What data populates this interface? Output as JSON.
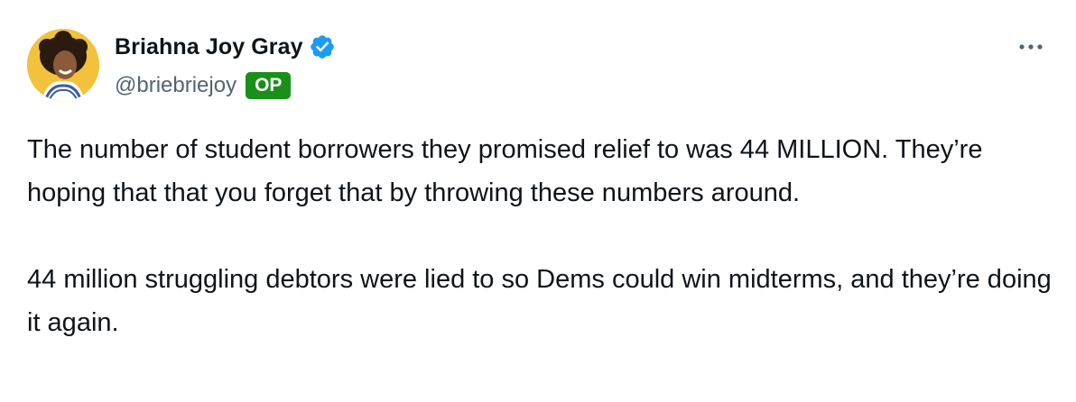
{
  "author": {
    "display_name": "Briahna Joy Gray",
    "handle": "@briebriejoy",
    "badge": "OP",
    "verified": true,
    "avatar_icon": "avatar-photo"
  },
  "menu": {
    "icon": "more-icon"
  },
  "tweet": {
    "paragraphs": [
      "The number of student borrowers they promised relief to was 44 MILLION. They’re hoping that that you forget that by throwing these numbers around.",
      "44 million struggling debtors were lied to so Dems could win midterms, and they’re doing it again."
    ]
  },
  "colors": {
    "verified": "#1d9bf0",
    "badge_bg": "#1a8f1a",
    "secondary_text": "#536471",
    "primary_text": "#0f1419"
  }
}
